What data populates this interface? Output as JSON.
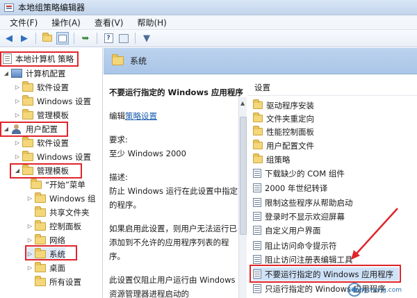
{
  "window": {
    "title": "本地组策略编辑器"
  },
  "menu": [
    "文件(F)",
    "操作(A)",
    "查看(V)",
    "帮助(H)"
  ],
  "tree": {
    "root": "本地计算机 策略",
    "computer": "计算机配置",
    "computer_children": [
      "软件设置",
      "Windows 设置",
      "管理模板"
    ],
    "user": "用户配置",
    "user_children": [
      "软件设置",
      "Windows 设置"
    ],
    "admin_templates": "管理模板",
    "admin_children": [
      "“开始”菜单",
      "Windows 组",
      "共享文件夹",
      "控制面板",
      "网络",
      "系统",
      "桌面",
      "所有设置"
    ]
  },
  "header": {
    "title": "系统"
  },
  "description": {
    "policy_title": "不要运行指定的 Windows 应用程序",
    "edit_prefix": "编辑",
    "edit_link": "策略设置",
    "req_label": "要求:",
    "req_value": "至少 Windows 2000",
    "desc_label": "描述:",
    "desc_text": "防止 Windows 运行在此设置中指定的程序。",
    "desc_text2": "如果启用此设置，则用户无法运行已添加到不允许的应用程序列表的程序。",
    "desc_text3": "此设置仅阻止用户运行由 Windows 资源管理器进程启动的"
  },
  "settings": {
    "column": "设置",
    "folders": [
      "驱动程序安装",
      "文件夹重定向",
      "性能控制面板",
      "用户配置文件",
      "组策略"
    ],
    "items": [
      "下载缺少的 COM 组件",
      "2000 年世纪转译",
      "限制这些程序从帮助启动",
      "登录时不显示欢迎屏幕",
      "自定义用户界面",
      "阻止访问命令提示符",
      "阻止访问注册表编辑工具",
      "不要运行指定的 Windows 应用程序",
      "只运行指定的 Windows 应用程序"
    ]
  },
  "watermark": {
    "text": "xitongcheng.com"
  }
}
